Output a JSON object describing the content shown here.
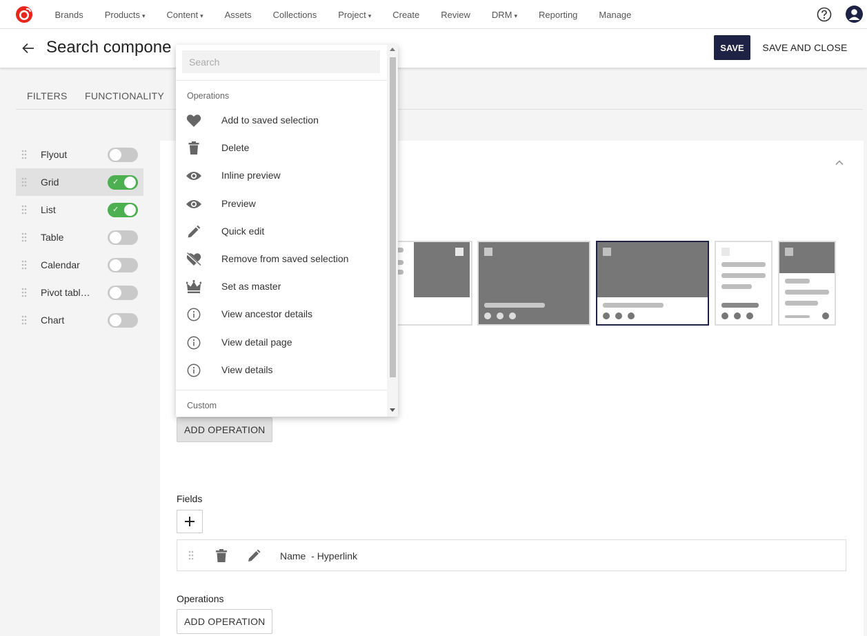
{
  "nav": {
    "items": [
      {
        "label": "Brands",
        "dropdown": false
      },
      {
        "label": "Products",
        "dropdown": true
      },
      {
        "label": "Content",
        "dropdown": true
      },
      {
        "label": "Assets",
        "dropdown": false
      },
      {
        "label": "Collections",
        "dropdown": false
      },
      {
        "label": "Project",
        "dropdown": true
      },
      {
        "label": "Create",
        "dropdown": false
      },
      {
        "label": "Review",
        "dropdown": false
      },
      {
        "label": "DRM",
        "dropdown": true
      },
      {
        "label": "Reporting",
        "dropdown": false
      },
      {
        "label": "Manage",
        "dropdown": false
      }
    ],
    "caret": "▾"
  },
  "header": {
    "title": "Search compone",
    "save_label": "SAVE",
    "save_close_label": "SAVE AND CLOSE"
  },
  "tabs": [
    "FILTERS",
    "FUNCTIONALITY"
  ],
  "views": [
    {
      "label": "Flyout",
      "enabled": false,
      "selected": false
    },
    {
      "label": "Grid",
      "enabled": true,
      "selected": true
    },
    {
      "label": "List",
      "enabled": true,
      "selected": false
    },
    {
      "label": "Table",
      "enabled": false,
      "selected": false
    },
    {
      "label": "Calendar",
      "enabled": false,
      "selected": false
    },
    {
      "label": "Pivot tabl…",
      "enabled": false,
      "selected": false
    },
    {
      "label": "Chart",
      "enabled": false,
      "selected": false
    }
  ],
  "dropdown": {
    "search_placeholder": "Search",
    "operations_heading": "Operations",
    "items": [
      {
        "label": "Add to saved selection",
        "icon": "heart-icon"
      },
      {
        "label": "Delete",
        "icon": "trash-icon"
      },
      {
        "label": "Inline preview",
        "icon": "eye-icon"
      },
      {
        "label": "Preview",
        "icon": "eye-icon"
      },
      {
        "label": "Quick edit",
        "icon": "pencil-icon"
      },
      {
        "label": "Remove from saved selection",
        "icon": "heart-off-icon"
      },
      {
        "label": "Set as master",
        "icon": "crown-icon"
      },
      {
        "label": "View ancestor details",
        "icon": "info-icon"
      },
      {
        "label": "View detail page",
        "icon": "info-icon"
      },
      {
        "label": "View details",
        "icon": "info-icon"
      }
    ],
    "custom_heading": "Custom"
  },
  "main": {
    "add_operation_label": "ADD OPERATION",
    "fields_label": "Fields",
    "plus_label": "+",
    "field_row": {
      "name": "Name",
      "suffix": "  - Hyperlink"
    },
    "operations_label": "Operations",
    "add_operation_label_2": "ADD OPERATION"
  },
  "colors": {
    "primary": "#1e2345",
    "toggle_on": "#4caf50",
    "logo": "#e8261c"
  }
}
